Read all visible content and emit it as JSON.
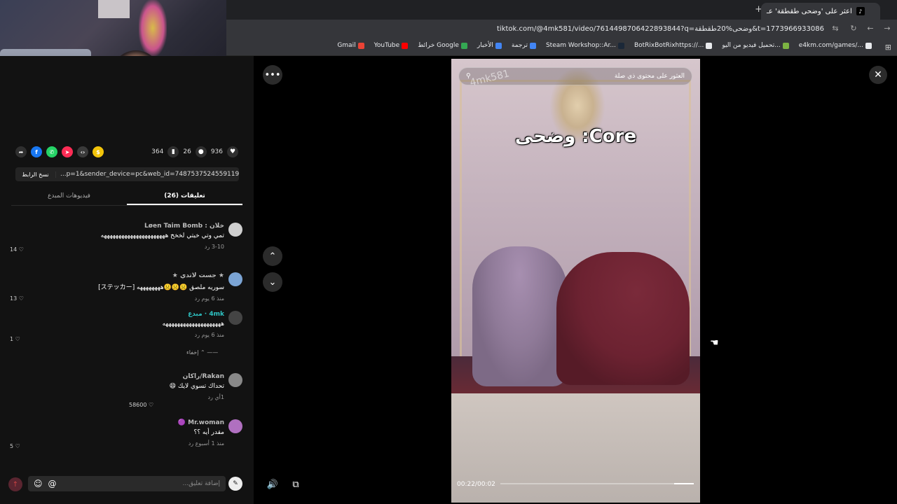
{
  "browser": {
    "tab_title": "اعثر على 'وضحى طقطقة' عـ",
    "tab_favicon": "tiktok-icon",
    "url": "tiktok.com/@4mk581/video/7614498706422893844?q=وضحى%20طقطقة&t=1773966933086",
    "bookmarks": [
      {
        "label": "Gmail",
        "color": "#ea4335"
      },
      {
        "label": "YouTube",
        "color": "#ff0000"
      },
      {
        "label": "خرائط Google",
        "color": "#34a853"
      },
      {
        "label": "الأخبار",
        "color": "#4285f4"
      },
      {
        "label": "ترجمة",
        "color": "#4285f4"
      },
      {
        "label": "Steam Workshop::Ar...",
        "color": "#1b2838"
      },
      {
        "label": "BotRixBotRixhttps://...",
        "color": "#e8eaed"
      },
      {
        "label": "تحميل فيديو من اليو...",
        "color": "#7cb342"
      },
      {
        "label": "e4km.com/games/...",
        "color": "#e8eaed"
      }
    ]
  },
  "post": {
    "likes": "936",
    "comments": "26",
    "saves": "364",
    "share_link": "...p=1&sender_device=pc&web_id=7487537524559119927",
    "copy_link_label": "نسخ الرابط",
    "share_icons": [
      "coin-icon",
      "embed-icon",
      "send-icon",
      "whatsapp-icon",
      "facebook-icon",
      "share-arrow-icon"
    ],
    "share_colors": [
      "#f2c40a",
      "#3a3a3a",
      "#fe2c55",
      "#25d366",
      "#1877f2",
      "#2f2f2f"
    ]
  },
  "tabs": {
    "comments": "تعليقات (26)",
    "creator_videos": "فيديوهات المبدع"
  },
  "comments": [
    {
      "name": "خلان : Løen Taim Bomb",
      "text": "تمي وتي خيتي لخخخ ههههههههههههههههههههههه",
      "meta": "3-10   رد",
      "likes": "14",
      "avatar": "#cfcfcf",
      "creator": false
    },
    {
      "name": "★ جست لاتدي ★",
      "text": "سوريه ملصق ☹️☹️☹️ههههههههه [ステッカー]",
      "meta": "منذ 6 يوم   رد",
      "likes": "13",
      "avatar": "#7ba4d4",
      "creator": false
    },
    {
      "name": "4mk · مبدع",
      "text": "ههههههههههههههههههههه",
      "meta": "منذ 6 يوم   رد",
      "likes": "1",
      "avatar": "#444",
      "creator": true
    },
    {
      "name": "Rakan/راكان",
      "text": "تحداك تسوي لايك 😄",
      "meta": "رد",
      "likes": "58600",
      "avatar": "#888",
      "creator": false,
      "meta_prefix": "1أي"
    },
    {
      "name": "Mr.woman 🟣",
      "text": "مقدر أيه ؟؟",
      "meta": "منذ 1 أسبوع   رد",
      "likes": "5",
      "avatar": "#b070c0",
      "creator": false
    }
  ],
  "hide_label": "إخفاء",
  "comment_input": {
    "placeholder": "إضافة تعليق..."
  },
  "video": {
    "search_placeholder": "العثور على محتوى ذي صلة",
    "watermark": "4mk581",
    "caption": "وضحى :Core",
    "time": "00:22/00:02",
    "progress": 0.1
  }
}
